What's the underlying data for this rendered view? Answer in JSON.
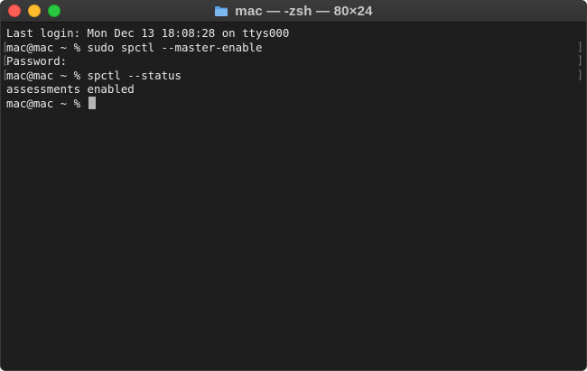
{
  "window": {
    "title": "mac — -zsh — 80×24"
  },
  "terminal": {
    "lines": [
      {
        "text": "Last login: Mon Dec 13 18:08:28 on ttys000",
        "marked": false
      },
      {
        "text": "mac@mac ~ % sudo spctl --master-enable",
        "marked": true
      },
      {
        "text": "Password:",
        "marked": true
      },
      {
        "text": "mac@mac ~ % spctl --status",
        "marked": true
      },
      {
        "text": "assessments enabled",
        "marked": false
      },
      {
        "text": "mac@mac ~ % ",
        "marked": false
      }
    ]
  },
  "colors": {
    "background": "#1e1e1e",
    "text": "#e8e8e8",
    "close": "#ff5f57",
    "minimize": "#febc2e",
    "maximize": "#28c840",
    "folder": "#5aa0e6"
  },
  "icons": {
    "title_icon": "folder-icon"
  }
}
